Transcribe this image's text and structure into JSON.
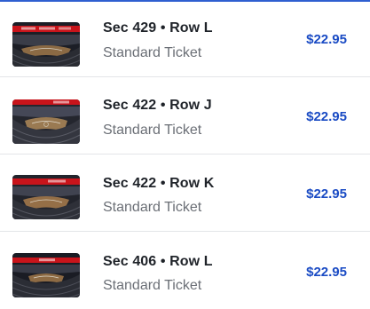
{
  "listings": [
    {
      "section": "Sec 429",
      "separator": "•",
      "row": "Row L",
      "ticket_type": "Standard Ticket",
      "price": "$22.95",
      "thumbnail": "arena-seat-view-image"
    },
    {
      "section": "Sec 422",
      "separator": "•",
      "row": "Row J",
      "ticket_type": "Standard Ticket",
      "price": "$22.95",
      "thumbnail": "arena-seat-view-image"
    },
    {
      "section": "Sec 422",
      "separator": "•",
      "row": "Row K",
      "ticket_type": "Standard Ticket",
      "price": "$22.95",
      "thumbnail": "arena-seat-view-image"
    },
    {
      "section": "Sec 406",
      "separator": "•",
      "row": "Row L",
      "ticket_type": "Standard Ticket",
      "price": "$22.95",
      "thumbnail": "arena-seat-view-image"
    }
  ],
  "colors": {
    "price": "#1a4bc4",
    "title": "#1f2329",
    "subtitle": "#6b6f76",
    "divider": "#e3e5e8",
    "accent_rule": "#2f5fd0"
  }
}
